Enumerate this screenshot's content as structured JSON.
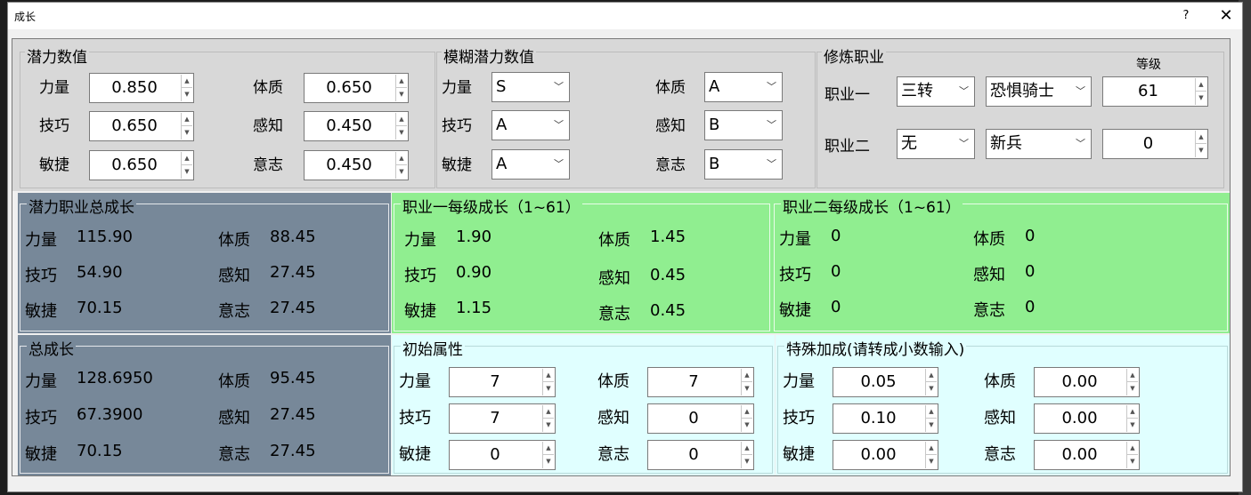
{
  "window": {
    "title": "成长",
    "help_glyph": "?",
    "close_glyph": "✕"
  },
  "potential": {
    "title": "潜力数值",
    "strength": {
      "label": "力量",
      "value": "0.850"
    },
    "physique": {
      "label": "体质",
      "value": "0.650"
    },
    "skill": {
      "label": "技巧",
      "value": "0.650"
    },
    "perception": {
      "label": "感知",
      "value": "0.450"
    },
    "agility": {
      "label": "敏捷",
      "value": "0.650"
    },
    "will": {
      "label": "意志",
      "value": "0.450"
    }
  },
  "fuzzy": {
    "title": "模糊潜力数值",
    "strength": {
      "label": "力量",
      "value": "S"
    },
    "physique": {
      "label": "体质",
      "value": "A"
    },
    "skill": {
      "label": "技巧",
      "value": "A"
    },
    "perception": {
      "label": "感知",
      "value": "B"
    },
    "agility": {
      "label": "敏捷",
      "value": "A"
    },
    "will": {
      "label": "意志",
      "value": "B"
    }
  },
  "job": {
    "title": "修炼职业",
    "level_header": "等级",
    "job1": {
      "label": "职业一",
      "tier": "三转",
      "class": "恐惧骑士",
      "level": "61"
    },
    "job2": {
      "label": "职业二",
      "tier": "无",
      "class": "新兵",
      "level": "0"
    }
  },
  "potential_total": {
    "title": "潜力职业总成长",
    "rows": [
      {
        "l1": "力量",
        "v1": "115.90",
        "l2": "体质",
        "v2": "88.45"
      },
      {
        "l1": "技巧",
        "v1": "54.90",
        "l2": "感知",
        "v2": "27.45"
      },
      {
        "l1": "敏捷",
        "v1": "70.15",
        "l2": "意志",
        "v2": "27.45"
      }
    ]
  },
  "job1_growth": {
    "title": "职业一每级成长（1~61）",
    "rows": [
      {
        "l1": "力量",
        "v1": "1.90",
        "l2": "体质",
        "v2": "1.45"
      },
      {
        "l1": "技巧",
        "v1": "0.90",
        "l2": "感知",
        "v2": "0.45"
      },
      {
        "l1": "敏捷",
        "v1": "1.15",
        "l2": "意志",
        "v2": "0.45"
      }
    ]
  },
  "job2_growth": {
    "title": "职业二每级成长（1~61）",
    "rows": [
      {
        "l1": "力量",
        "v1": "0",
        "l2": "体质",
        "v2": "0"
      },
      {
        "l1": "技巧",
        "v1": "0",
        "l2": "感知",
        "v2": "0"
      },
      {
        "l1": "敏捷",
        "v1": "0",
        "l2": "意志",
        "v2": "0"
      }
    ]
  },
  "total_growth": {
    "title": "总成长",
    "rows": [
      {
        "l1": "力量",
        "v1": "128.6950",
        "l2": "体质",
        "v2": "95.45"
      },
      {
        "l1": "技巧",
        "v1": "67.3900",
        "l2": "感知",
        "v2": "27.45"
      },
      {
        "l1": "敏捷",
        "v1": "70.15",
        "l2": "意志",
        "v2": "27.45"
      }
    ]
  },
  "initial": {
    "title": "初始属性",
    "rows": [
      {
        "l1": "力量",
        "v1": "7",
        "l2": "体质",
        "v2": "7"
      },
      {
        "l1": "技巧",
        "v1": "7",
        "l2": "感知",
        "v2": "0"
      },
      {
        "l1": "敏捷",
        "v1": "0",
        "l2": "意志",
        "v2": "0"
      }
    ]
  },
  "bonus": {
    "title": "特殊加成(请转成小数输入)",
    "rows": [
      {
        "l1": "力量",
        "v1": "0.05",
        "l2": "体质",
        "v2": "0.00"
      },
      {
        "l1": "技巧",
        "v1": "0.10",
        "l2": "感知",
        "v2": "0.00"
      },
      {
        "l1": "敏捷",
        "v1": "0.00",
        "l2": "意志",
        "v2": "0.00"
      }
    ]
  },
  "colors": {
    "slate": "#778899",
    "green": "#90ee90",
    "cyan": "#e0ffff",
    "gray": "#d8d8d8"
  }
}
